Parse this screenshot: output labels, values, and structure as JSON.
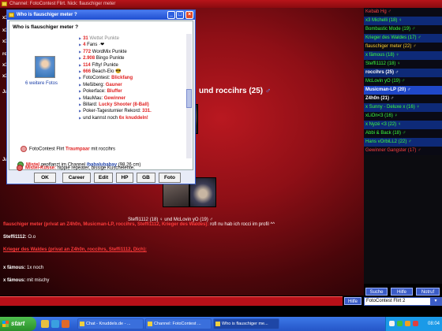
{
  "window": {
    "title": "Channel: FotoContest Flirt. Nick: flauschiger meter",
    "colors": {
      "chat_bg": "#b91820",
      "accent_blue": "#3b5cc6",
      "taskbar": "#2556c8"
    }
  },
  "chat": {
    "side_labels": [
      "x3",
      "x3",
      "x3",
      "ro",
      "x3",
      "x3",
      "Ja",
      "Ja"
    ],
    "heading_text": "und roccihrs (25)",
    "heading_icon": "male-icon",
    "photo_caption": "Steffi1112 (18) ♀ und McLovin yO (19) ♂",
    "lines": {
      "private_to_label": "flauschiger meter (privat an Z4h0n, Musicman-LP, roccihrs, Steffi1112, Krieger des Waldes):",
      "private_to_text": " rofl nu hab ich rocci im profil ^^",
      "steffi_name": "Steffi1112:",
      "steffi_text": " O.o",
      "krieger_label": "Krieger des Waldes (privat an Z4h0n, roccihrs, Steffi1112, Dich):",
      "famous1_name": "x fämous:",
      "famous1_text": " 1x noch",
      "famous2_name": "x fämous:",
      "famous2_text": " mit mischy"
    },
    "hilfe_button": "Hilfe"
  },
  "userlist": {
    "items": [
      {
        "text": "Kebab Hg ♂",
        "color": "red",
        "bg": "bg2"
      },
      {
        "text": "x3 Michelli (18) ♀",
        "color": "green",
        "bg": "bg1"
      },
      {
        "text": "Bombastic Mode (19) ♂",
        "color": "green",
        "bg": "bg2"
      },
      {
        "text": "Krieger des Waldes (17) ♂",
        "color": "green",
        "bg": "bg1"
      },
      {
        "text": "flauschiger meter (22) ♂",
        "color": "yellow",
        "bg": "bg2"
      },
      {
        "text": "x fämous (18) ♀",
        "color": "green",
        "bg": "bg1"
      },
      {
        "text": "Steffi1112 (18) ♀",
        "color": "green",
        "bg": "bg2"
      },
      {
        "text": "roccihrs (25) ♂",
        "color": "white",
        "bg": "bg1"
      },
      {
        "text": "McLovin yO (19) ♂",
        "color": "green",
        "bg": "bg2"
      },
      {
        "text": "Musicman-LP (20) ♂",
        "color": "white",
        "bg": "sel"
      },
      {
        "text": "Z4h0n (21) ♂",
        "color": "white",
        "bg": "bg2"
      },
      {
        "text": "x Sunny - Deluxe x (16) ♀",
        "color": "green",
        "bg": "bg1"
      },
      {
        "text": "xLiOn<3 (16) ♀",
        "color": "green",
        "bg": "bg2"
      },
      {
        "text": "x Nyzé <3 (22) ♀",
        "color": "green",
        "bg": "bg1"
      },
      {
        "text": "Abbi & Back (18) ♂",
        "color": "green",
        "bg": "bg2"
      },
      {
        "text": "Hans vOrbiLL2 (22) ♂",
        "color": "green",
        "bg": "bg1"
      },
      {
        "text": "Gewinner Gangster (17) ♂",
        "color": "red",
        "bg": "bg2"
      }
    ],
    "buttons": {
      "suche": "Suche",
      "hilfe": "Hilfe",
      "notruf": "Notruf"
    },
    "channel_select": "FotoContest Flirt 2"
  },
  "dialog": {
    "title": "Who is flauschiger meter ?",
    "heading": "Who is flauschiger meter ?",
    "more_photos": "6 weitere Fotos",
    "stats": [
      {
        "num": "31",
        "label": " Wettet Punkte",
        "faded": true
      },
      {
        "num": "4",
        "label": " Fans ·❤"
      },
      {
        "num": "772",
        "label": " WordMix Punkte"
      },
      {
        "num": "2.908",
        "label": " Bingo Punkte"
      },
      {
        "num": "114",
        "label": " Fifty! Punkte"
      },
      {
        "num": "666",
        "label": " Beach-Elo 😎"
      },
      {
        "label": "FotoContest: ",
        "val": "Blickfang"
      },
      {
        "label": "Meßiberg: ",
        "val": "Gauner"
      },
      {
        "label": "Pokerface: ",
        "val": "Bluffer"
      },
      {
        "label": "MauMau: ",
        "val": "Gewinner"
      },
      {
        "label": "Billard: ",
        "val": "Lucky Shooter (8-Ball)"
      },
      {
        "label": "Poker-Tagesturnier Rekord: ",
        "val": "331."
      },
      {
        "label": "und kannst noch ",
        "val": "6x knuddeln!"
      }
    ],
    "events": {
      "e1_pre": "FotoContest Flirt ",
      "e1_bold": "Traumpaar",
      "e1_post": " mit roccihrs",
      "e2_name": "Mistel",
      "e2_mid": " gepflanzt im Channel ",
      "e2_channel": "/babalubabay",
      "e2_post": " (98,26 cm)",
      "e3_name": "Mistel-Küsse:",
      "e3_text": " nippie repeater, bissige Kuschelente,"
    },
    "buttons": [
      "OK",
      "Career",
      "Edit",
      "HP",
      "GB",
      "Foto"
    ]
  },
  "taskbar": {
    "start": "start",
    "tasks": [
      "Chat - Knuddels.de - ...",
      "Channel: FotoContest ...",
      "Who is flauschiger me..."
    ],
    "clock": "08:04"
  }
}
